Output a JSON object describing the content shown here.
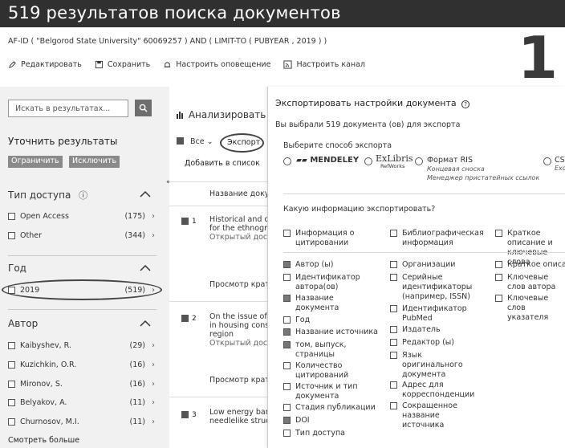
{
  "header": {
    "title": "519 результатов поиска документов"
  },
  "query": "AF-ID ( \"Belgorod State University\" 60069257 ) AND ( LIMIT-TO ( PUBYEAR , 2019 ) )",
  "toolbar": {
    "edit": "Редактировать",
    "save": "Сохранить",
    "alert": "Настроить оповещение",
    "feed": "Настроить канал"
  },
  "overlay_number": "1",
  "sidebar": {
    "search_placeholder": "Искать в результатах...",
    "refine_title": "Уточнить результаты",
    "limit_btn": "Ограничить",
    "exclude_btn": "Исключить",
    "access": {
      "title": "Тип доступа",
      "info": "ⓘ",
      "items": [
        {
          "label": "Open Access",
          "count": "(175)"
        },
        {
          "label": "Other",
          "count": "(344)"
        }
      ]
    },
    "year": {
      "title": "Год",
      "items": [
        {
          "label": "2019",
          "count": "(519)"
        }
      ]
    },
    "author": {
      "title": "Автор",
      "items": [
        {
          "label": "Kaibyshev, R.",
          "count": "(29)"
        },
        {
          "label": "Kuzichkin, O.R.",
          "count": "(16)"
        },
        {
          "label": "Mironov, S.",
          "count": "(16)"
        },
        {
          "label": "Belyakov, A.",
          "count": "(11)"
        },
        {
          "label": "Churnosov, M.I.",
          "count": "(11)"
        }
      ]
    },
    "more": "Смотреть больше"
  },
  "main": {
    "analyze": "Анализировать р",
    "all": "Все",
    "export": "Экспорт",
    "add_to_list": "Добавить в список",
    "col_title": "Название доку",
    "rows": [
      {
        "num": "1",
        "line1": "Historical and cu",
        "line2": "for the ethnogra",
        "line3": "Открытый дост",
        "view": "Просмотр крат"
      },
      {
        "num": "2",
        "line1": "On the issue of p",
        "line2": "in housing const",
        "line3": "region",
        "line4": "Открытый дост",
        "view": "Просмотр крат"
      },
      {
        "num": "3",
        "line1": "Low energy ban",
        "line2": "needlelike struct"
      }
    ]
  },
  "dialog": {
    "title": "Экспортировать настройки документа",
    "help": "?",
    "selected": "Вы выбрали 519 документа (ов) для экспорта",
    "method_label": "Выберите способ экспорта",
    "mendeley": "MENDELEY",
    "exlibris": "ExLibris",
    "refworks": "RefWorks",
    "ris": "Формат RIS",
    "ris_sub1": "Концевая сноска",
    "ris_sub2": "Менеджер пристатейных ссылок",
    "csv": "CSV",
    "csv_sub": "Exc",
    "question": "Какую информацию экспортировать?",
    "groups": {
      "citation": "Информация о цитировании",
      "biblio": "Библиографическая информация",
      "abstract": "Краткое описание и ключевые слова"
    },
    "col1": [
      {
        "label": "Автор (ы)",
        "checked": true
      },
      {
        "label": "Идентификатор автора(ов)",
        "checked": false
      },
      {
        "label": "Название документа",
        "checked": true
      },
      {
        "label": "Год",
        "checked": false
      },
      {
        "label": "Название источника",
        "checked": true
      },
      {
        "label": "том, выпуск, страницы",
        "checked": true
      },
      {
        "label": "Количество цитирований",
        "checked": false
      },
      {
        "label": "Источник и тип документа",
        "checked": false
      },
      {
        "label": "Стадия публикации",
        "checked": false
      },
      {
        "label": "DOI",
        "checked": true
      },
      {
        "label": "Тип доступа",
        "checked": false
      }
    ],
    "col2": [
      {
        "label": "Организации",
        "checked": false
      },
      {
        "label": "Серийные идентификаторы (например, ISSN)",
        "checked": false
      },
      {
        "label": "Идентификатор PubMed",
        "checked": false
      },
      {
        "label": "Издатель",
        "checked": false
      },
      {
        "label": "Редактор (ы)",
        "checked": false
      },
      {
        "label": "Язык оригинального документа",
        "checked": false
      },
      {
        "label": "Адрес для корреспонденции",
        "checked": false
      },
      {
        "label": "Сокращенное название источника",
        "checked": false
      }
    ],
    "col3": [
      {
        "label": "Краткое описан",
        "checked": false
      },
      {
        "label": "Ключевые слов автора",
        "checked": false
      },
      {
        "label": "Ключевые слов указателя",
        "checked": false
      }
    ]
  }
}
